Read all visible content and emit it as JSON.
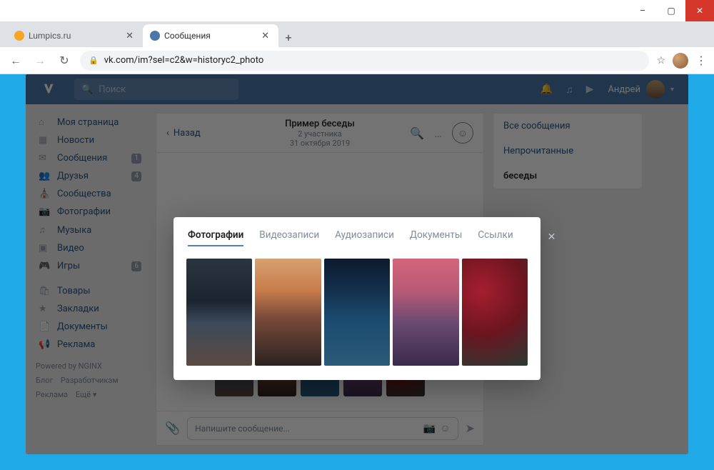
{
  "window": {
    "min": "–",
    "max": "▢",
    "close": "✕"
  },
  "tabs": [
    {
      "title": "Lumpics.ru",
      "favicon_bg": "#f5a623"
    },
    {
      "title": "Сообщения",
      "favicon_bg": "#4a76a8"
    }
  ],
  "browser": {
    "url": "vk.com/im?sel=c2&w=historyc2_photo",
    "plus": "+"
  },
  "vkheader": {
    "search_placeholder": "Поиск",
    "username": "Андрей"
  },
  "sidebar": {
    "items": [
      {
        "icon": "⌂",
        "label": "Моя страница"
      },
      {
        "icon": "▦",
        "label": "Новости"
      },
      {
        "icon": "✉",
        "label": "Сообщения",
        "badge": "1"
      },
      {
        "icon": "👥",
        "label": "Друзья",
        "badge": "4"
      },
      {
        "icon": "⛪",
        "label": "Сообщества"
      },
      {
        "icon": "📷",
        "label": "Фотографии"
      },
      {
        "icon": "♫",
        "label": "Музыка"
      },
      {
        "icon": "▣",
        "label": "Видео"
      },
      {
        "icon": "🎮",
        "label": "Игры",
        "badge": "6"
      }
    ],
    "items2": [
      {
        "icon": "🛍",
        "label": "Товары"
      },
      {
        "icon": "★",
        "label": "Закладки"
      },
      {
        "icon": "📄",
        "label": "Документы"
      },
      {
        "icon": "📢",
        "label": "Реклама"
      }
    ],
    "powered": "Powered by NGINX",
    "footer": [
      "Блог",
      "Разработчикам",
      "Реклама",
      "Ещё ▾"
    ]
  },
  "chat": {
    "back": "Назад",
    "title": "Пример беседы",
    "subtitle": "2 участника",
    "date": "31 октября 2019",
    "composer_placeholder": "Напишите сообщение..."
  },
  "rightpane": {
    "all": "Все сообщения",
    "unread": "Непрочитанные",
    "conv": "беседы"
  },
  "modal": {
    "tabs": [
      "Фотографии",
      "Видеозаписи",
      "Аудиозаписи",
      "Документы",
      "Ссылки"
    ],
    "active_tab": 0
  }
}
